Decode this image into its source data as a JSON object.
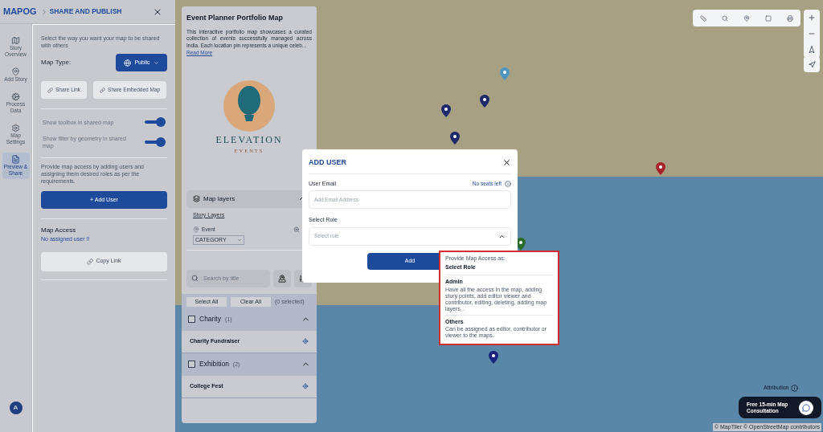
{
  "header": {
    "logo": "MAPOG",
    "title": "SHARE AND PUBLISH"
  },
  "nav": [
    {
      "label": "Story Overview",
      "selected": false
    },
    {
      "label": "Add Story",
      "selected": false
    },
    {
      "label": "Process Data",
      "selected": false
    },
    {
      "label": "Map Settings",
      "selected": false
    },
    {
      "label": "Preview & Share",
      "selected": true
    }
  ],
  "avatar": "A",
  "share": {
    "intro": "Select the way you want your map to be shared with others",
    "map_type_label": "Map Type:",
    "map_type": "Public",
    "buttons": [
      "Share Link",
      "Share Embedded Map"
    ],
    "toggles": [
      {
        "label": "Show toolbox in shared map",
        "on": true
      },
      {
        "label": "Show filter by geometry in shared map",
        "on": true
      }
    ],
    "access_text": "Provide map access by adding users and assigning them desired roles as per the requirements.",
    "add_user": "+ Add User",
    "access_title": "Map Access",
    "access_empty": "No assigned user !!",
    "copy_link": "Copy Link"
  },
  "story": {
    "title": "Event Planner Portfolio Map",
    "description": "This interactive portfolio map showcases a curated collection of events successfully managed across India. Each location pin represents a unique celeb...",
    "read_more": "Read More",
    "logo_title": "ELEVATION",
    "logo_subtitle": "EVENTS",
    "layers_title": "Map layers",
    "story_layers": "Story Layers",
    "layer": "Event",
    "category": "CATEGORY",
    "search_placeholder": "Search by title",
    "select_all": "Select All",
    "clear_all": "Clear All",
    "selected_count": "(0 selected)",
    "groups": [
      {
        "name": "Charity",
        "count": "(1)",
        "checked": false,
        "expanded": true,
        "items": [
          "Charity Fundraiser"
        ]
      },
      {
        "name": "Exhibition",
        "count": "(2)",
        "checked": false,
        "expanded": true,
        "items": [
          "College Fest"
        ]
      }
    ]
  },
  "map": {
    "pins": [
      {
        "color": "#4f97c0"
      },
      {
        "color": "#1e2a6a"
      },
      {
        "color": "#1e2a6a"
      },
      {
        "color": "#1e2a6a"
      },
      {
        "color": "#a8262b"
      },
      {
        "color": "#2a6b2e"
      },
      {
        "color": "#1a237e"
      }
    ],
    "attribution": "Attribution",
    "credits": "© MapTiler © OpenStreetMap contributors",
    "consultation": "Free 15-min Map Consultation"
  },
  "dialog": {
    "title": "ADD USER",
    "email_label": "User Email",
    "seats": "No seats left",
    "email_placeholder": "Add Email Address",
    "role_label": "Select Role",
    "role_placeholder": "Select role",
    "expanded": true,
    "add": "Add",
    "menu": {
      "caption": "Provide Map Access as:",
      "heading": "Select Role",
      "options": [
        {
          "name": "Admin",
          "description": "Have all the access in the map, adding story points, add editor viewer and contributor, editing, deleting, adding map layers, ."
        },
        {
          "name": "Others",
          "description": "Can be assigned as editor, contributor or viewer to the maps."
        }
      ]
    }
  }
}
